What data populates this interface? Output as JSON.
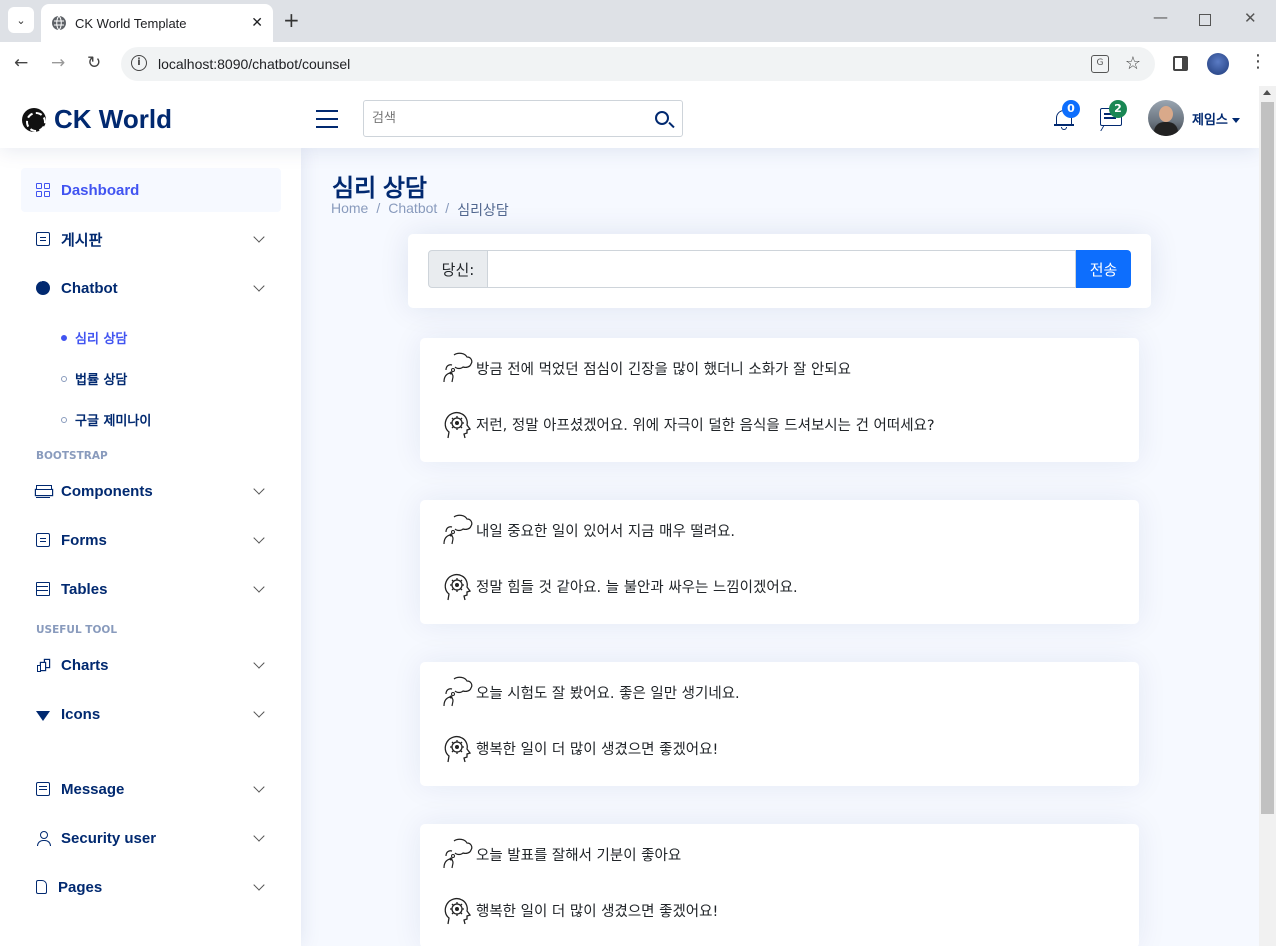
{
  "browser": {
    "tab_title": "CK World Template",
    "url": "localhost:8090/chatbot/counsel"
  },
  "header": {
    "logo": "CK World",
    "search_placeholder": "검색",
    "notifications_count": "0",
    "messages_count": "2",
    "user_name": "제임스"
  },
  "sidebar": {
    "dashboard": "Dashboard",
    "board": "게시판",
    "chatbot": "Chatbot",
    "sub_items": [
      "심리 상담",
      "법률 상담",
      "구글 제미나이"
    ],
    "heading_bootstrap": "BOOTSTRAP",
    "components": "Components",
    "forms": "Forms",
    "tables": "Tables",
    "heading_tool": "USEFUL TOOL",
    "charts": "Charts",
    "icons": "Icons",
    "message": "Message",
    "security": "Security user",
    "pages": "Pages"
  },
  "page": {
    "title": "심리 상담",
    "breadcrumb": [
      "Home",
      "Chatbot",
      "심리상담"
    ]
  },
  "chat_input": {
    "label": "당신:",
    "value": "",
    "send_label": "전송"
  },
  "conversations": [
    {
      "user": "방금 전에 먹었던 점심이 긴장을 많이 했더니 소화가 잘 안되요",
      "bot": "저런, 정말 아프셨겠어요. 위에 자극이 덜한 음식을 드셔보시는 건 어떠세요?"
    },
    {
      "user": "내일 중요한 일이 있어서 지금 매우 떨려요.",
      "bot": "정말 힘들 것 같아요. 늘 불안과 싸우는 느낌이겠어요."
    },
    {
      "user": "오늘 시험도 잘 봤어요. 좋은 일만 생기네요.",
      "bot": "행복한 일이 더 많이 생겼으면 좋겠어요!"
    },
    {
      "user": "오늘 발표를 잘해서 기분이 좋아요",
      "bot": "행복한 일이 더 많이 생겼으면 좋겠어요!"
    }
  ],
  "colors": {
    "brand": "#012970",
    "accent": "#4154f1",
    "primary_button": "#0d6efd",
    "badge_green": "#198754"
  }
}
